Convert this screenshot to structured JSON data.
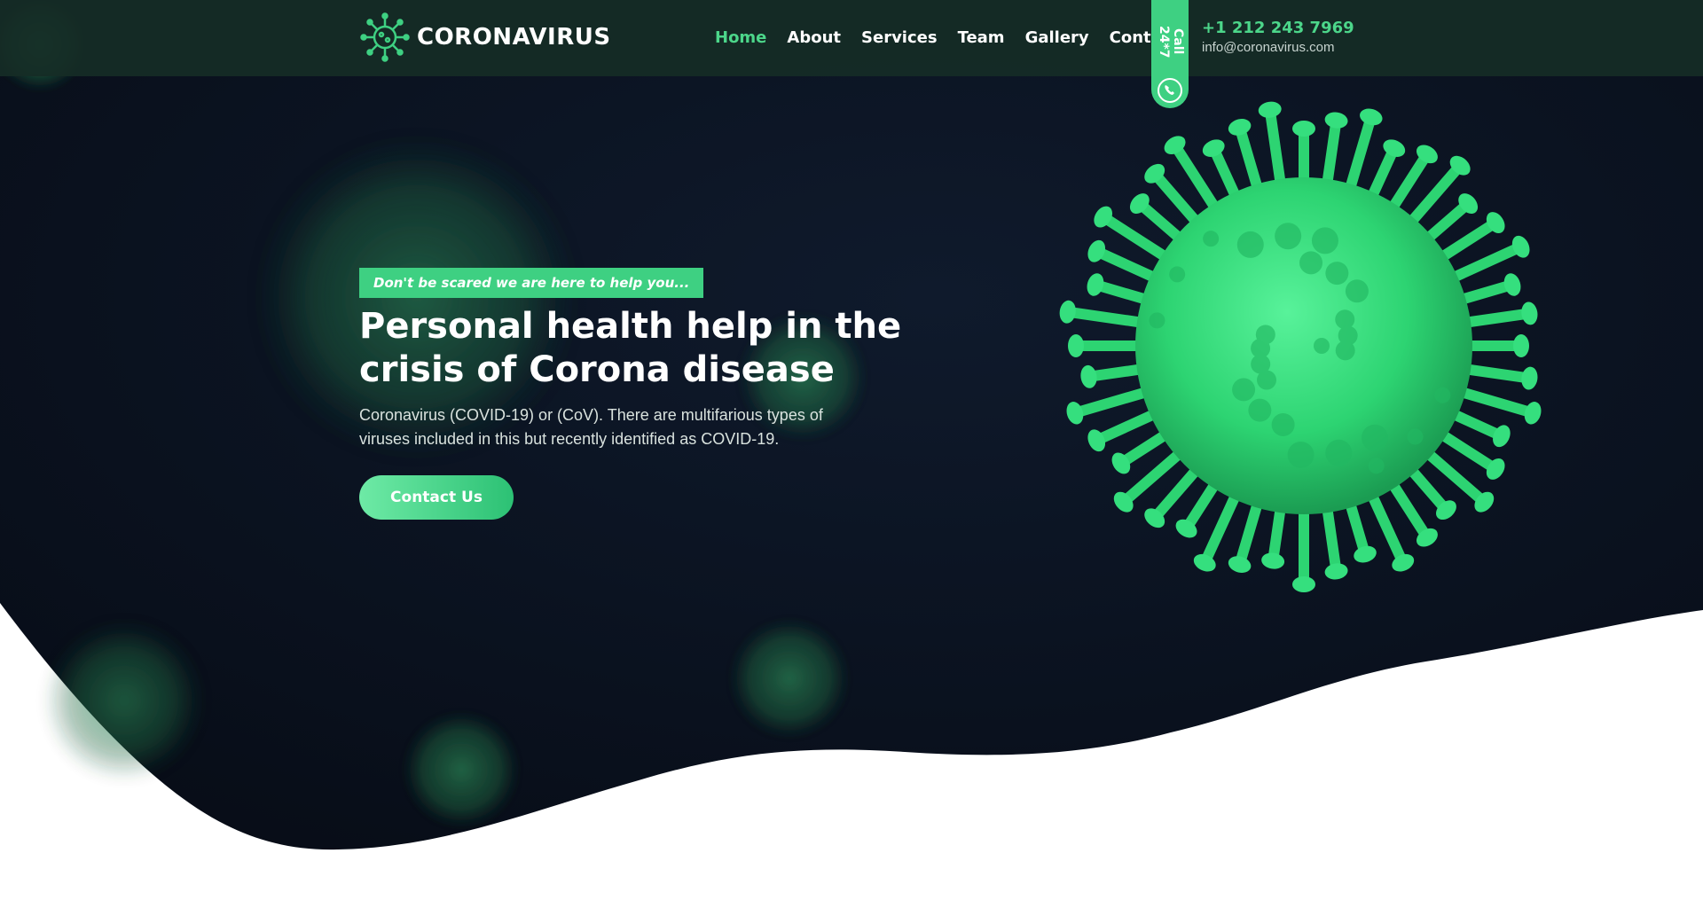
{
  "brand": {
    "name": "CORONAVIRUS",
    "accent_color": "#3ed082",
    "logo_icon": "virus-icon"
  },
  "nav": {
    "items": [
      {
        "label": "Home",
        "active": true
      },
      {
        "label": "About",
        "active": false
      },
      {
        "label": "Services",
        "active": false
      },
      {
        "label": "Team",
        "active": false
      },
      {
        "label": "Gallery",
        "active": false
      },
      {
        "label": "Contact",
        "active": false
      }
    ]
  },
  "call_badge": {
    "label": "Call 24*7",
    "icon": "phone-icon"
  },
  "contact": {
    "phone": "+1 212 243 7969",
    "email": "info@coronavirus.com"
  },
  "hero": {
    "tagline": "Don't be scared we are here to help you...",
    "headline_lines": [
      "Personal health help in the",
      "crisis of Corona disease"
    ],
    "description_lines": [
      "Coronavirus (COVID-19) or (CoV). There are multifarious types of",
      "viruses included in this but recently identified as COVID-19."
    ],
    "cta_label": "Contact Us",
    "background_color": "#0b111e",
    "virus_color": "#2fd77a"
  }
}
